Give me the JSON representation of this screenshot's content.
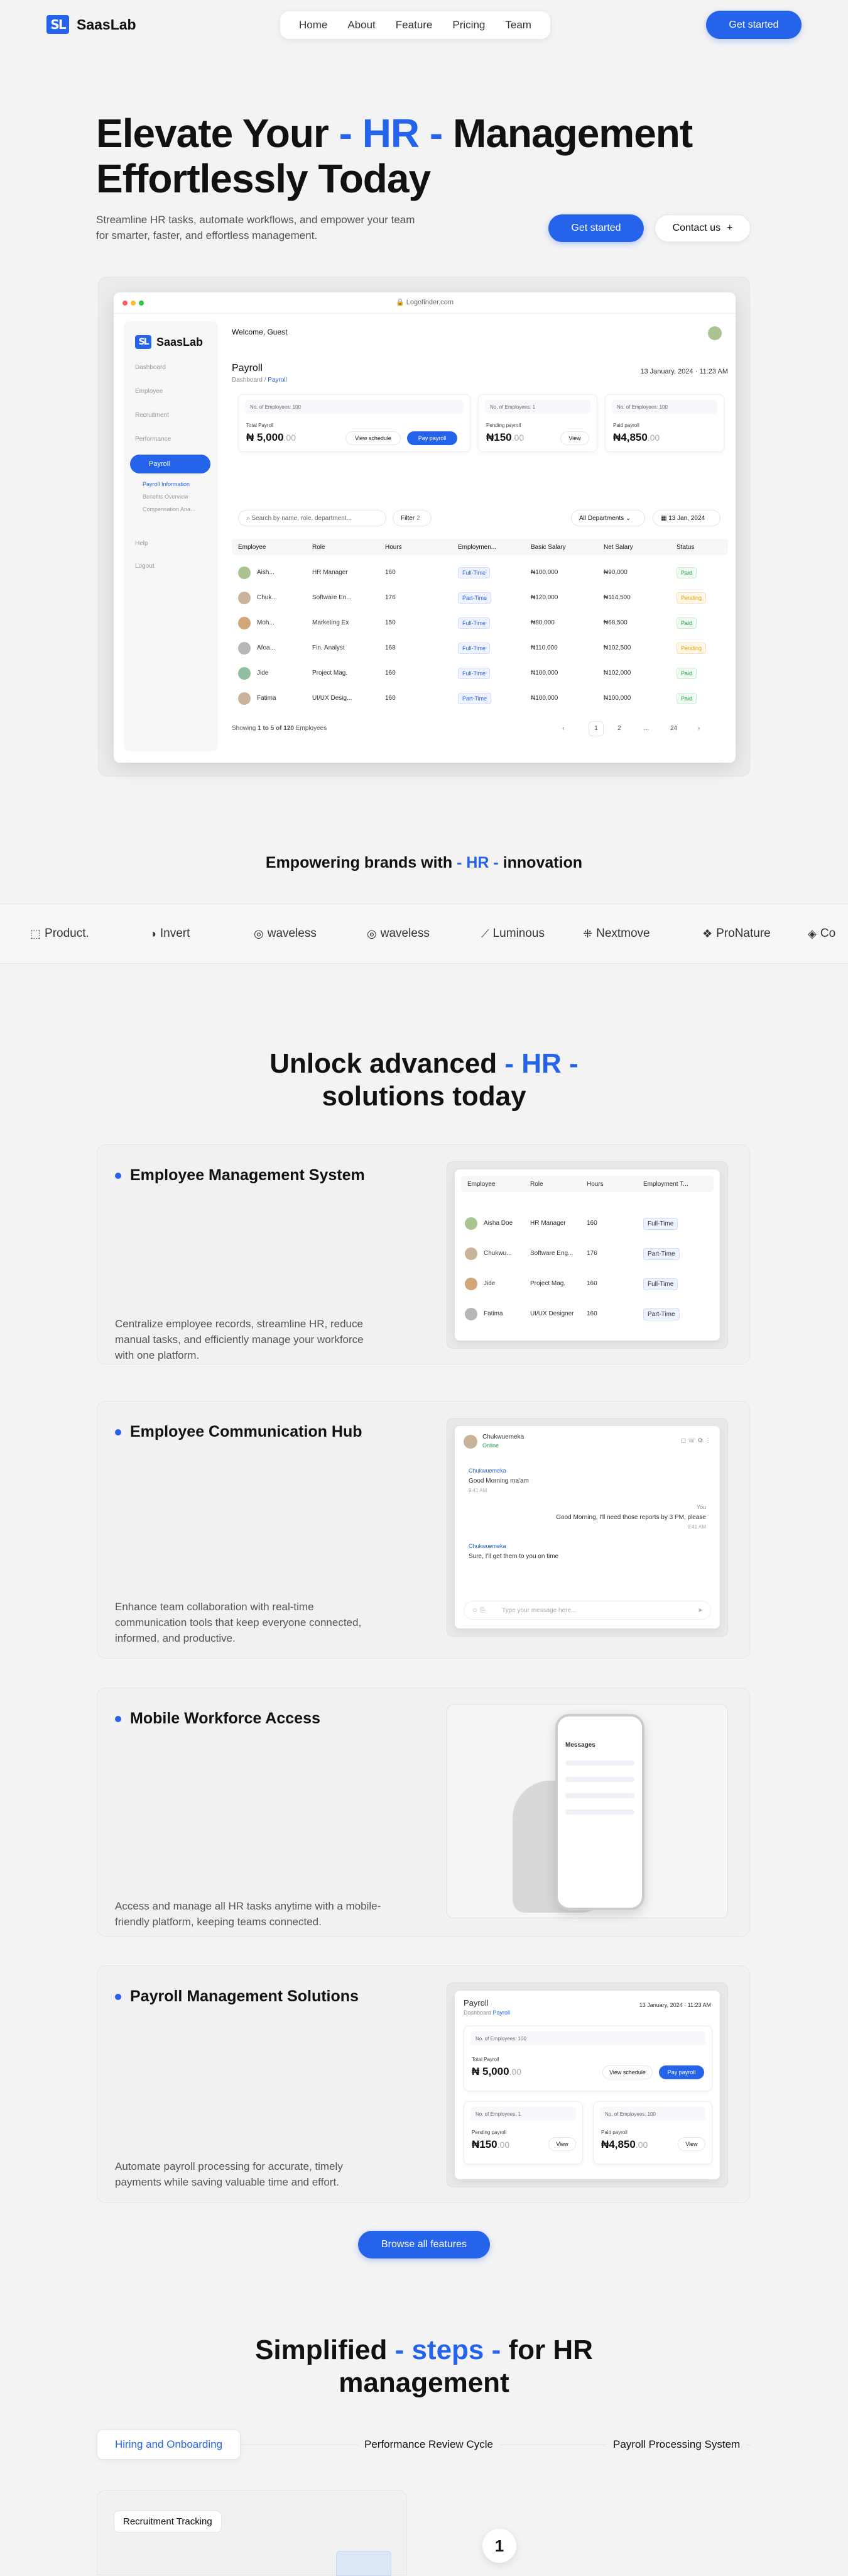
{
  "header": {
    "logo_mark": "SL",
    "brand": "SaasLab",
    "nav": [
      "Home",
      "About",
      "Feature",
      "Pricing",
      "Team"
    ],
    "cta": "Get started"
  },
  "hero": {
    "title_1": "Elevate Your ",
    "title_hl": "- HR -",
    "title_2": " Management",
    "title_3": "Effortlessly Today",
    "subtitle": "Streamline HR tasks, automate workflows, and empower your team for smarter, faster, and effortless management.",
    "cta_primary": "Get started",
    "cta_secondary": "Contact us",
    "cta_secondary_icon": "+"
  },
  "dashboard": {
    "url": "Logofinder.com",
    "brand": "SaasLab",
    "welcome": "Welcome, Guest",
    "sidebar": [
      "Dashboard",
      "Employee",
      "Recruitment",
      "Performance"
    ],
    "active": "Payroll",
    "submenu": [
      "Payroll Information",
      "Benefits Overview",
      "Compensation Ana..."
    ],
    "sidebar_bottom": [
      "Help",
      "Logout"
    ],
    "page_title": "Payroll",
    "crumb_1": "Dashboard",
    "crumb_2": "Payroll",
    "date": "13 January, 2024 · 11:23 AM",
    "cards": [
      {
        "tag": "No. of Employees: 100",
        "label": "Total Payroll",
        "value": "₦ 5,000",
        "dec": ".00"
      },
      {
        "tag": "No. of Employees: 1",
        "label": "Pending payroll",
        "value": "₦150",
        "dec": ".00"
      },
      {
        "tag": "No. of Employees: 100",
        "label": "Paid payroll",
        "value": "₦4,850",
        "dec": ".00"
      }
    ],
    "btn_schedule": "View schedule",
    "btn_pay": "Pay payroll",
    "btn_view": "View",
    "search_placeholder": "Search by name, role, department...",
    "filter": "Filter",
    "filter_count": "2",
    "dept": "All Departments",
    "date_pick": "13 Jan, 2024",
    "columns": [
      "Employee",
      "Role",
      "Hours",
      "Employmen...",
      "Basic Salary",
      "Net Salary",
      "Status"
    ],
    "rows": [
      [
        "Aish...",
        "HR Manager",
        "160",
        "Full-Time",
        "₦100,000",
        "₦90,000",
        "Paid"
      ],
      [
        "Chuk...",
        "Software En...",
        "176",
        "Part-Time",
        "₦120,000",
        "₦114,500",
        "Pending"
      ],
      [
        "Moh...",
        "Marketing Ex",
        "150",
        "Full-Time",
        "₦80,000",
        "₦68,500",
        "Paid"
      ],
      [
        "Afoa...",
        "Fin. Analyst",
        "168",
        "Full-Time",
        "₦110,000",
        "₦102,500",
        "Pending"
      ],
      [
        "Jide",
        "Project Mag.",
        "160",
        "Full-Time",
        "₦100,000",
        "₦102,000",
        "Paid"
      ],
      [
        "Fatima",
        "UI/UX Desig...",
        "160",
        "Part-Time",
        "₦100,000",
        "₦100,000",
        "Paid"
      ]
    ],
    "showing": "Showing",
    "showing_range": "1 to 5 of 120",
    "showing_suffix": "Employees",
    "pages": [
      "1",
      "2",
      "...",
      "24"
    ]
  },
  "brands": {
    "title_1": "Empowering brands with ",
    "title_hl": "- HR -",
    "title_2": " innovation",
    "items": [
      "Product.",
      "Invert",
      "waveless",
      "waveless",
      "Luminous",
      "Nextmove",
      "ProNature",
      "Co"
    ]
  },
  "features": {
    "title_1": "Unlock advanced ",
    "title_hl": "- HR -",
    "title_2": "solutions today",
    "items": [
      {
        "title": "Employee Management System",
        "desc": "Centralize employee records, streamline HR, reduce manual tasks, and efficiently manage your workforce with one platform."
      },
      {
        "title": "Employee Communication Hub",
        "desc": "Enhance team collaboration with real-time communication tools that keep everyone connected, informed, and productive."
      },
      {
        "title": "Mobile Workforce Access",
        "desc": "Access and manage all HR tasks anytime with a mobile-friendly platform, keeping teams connected."
      },
      {
        "title": "Payroll Management Solutions",
        "desc": "Automate payroll processing for accurate, timely payments while saving valuable time and effort."
      }
    ],
    "emp_cols": [
      "Employee",
      "Role",
      "Hours",
      "Employment T..."
    ],
    "emp_rows": [
      [
        "Aisha Doe",
        "HR Manager",
        "160",
        "Full-Time"
      ],
      [
        "Chukwu...",
        "Software Eng...",
        "176",
        "Part-Time"
      ],
      [
        "Jide",
        "Project Mag.",
        "160",
        "Full-Time"
      ],
      [
        "Fatima",
        "UI/UX Designer",
        "160",
        "Part-Time"
      ]
    ],
    "chat": {
      "name": "Chukwuemeka",
      "status": "Online",
      "m1_name": "Chukwuemeka",
      "m1": "Good Morning ma'am",
      "m1_time": "9:41 AM",
      "m2_name": "You",
      "m2": "Good Morning, I'll need those reports by 3 PM, please",
      "m2_time": "9:41 AM",
      "m3_name": "Chukwuemeka",
      "m3": "Sure, I'll get them to you on time",
      "placeholder": "Type your message here..."
    },
    "phone_title": "Messages",
    "browse": "Browse all features"
  },
  "steps": {
    "title_1": "Simplified ",
    "title_hl": "- steps -",
    "title_2": " for HR",
    "title_3": "management",
    "tabs": [
      "Hiring and Onboarding",
      "Performance Review Cycle",
      "Payroll Processing System"
    ],
    "card_label": "Recruitment Tracking",
    "number": "1"
  }
}
